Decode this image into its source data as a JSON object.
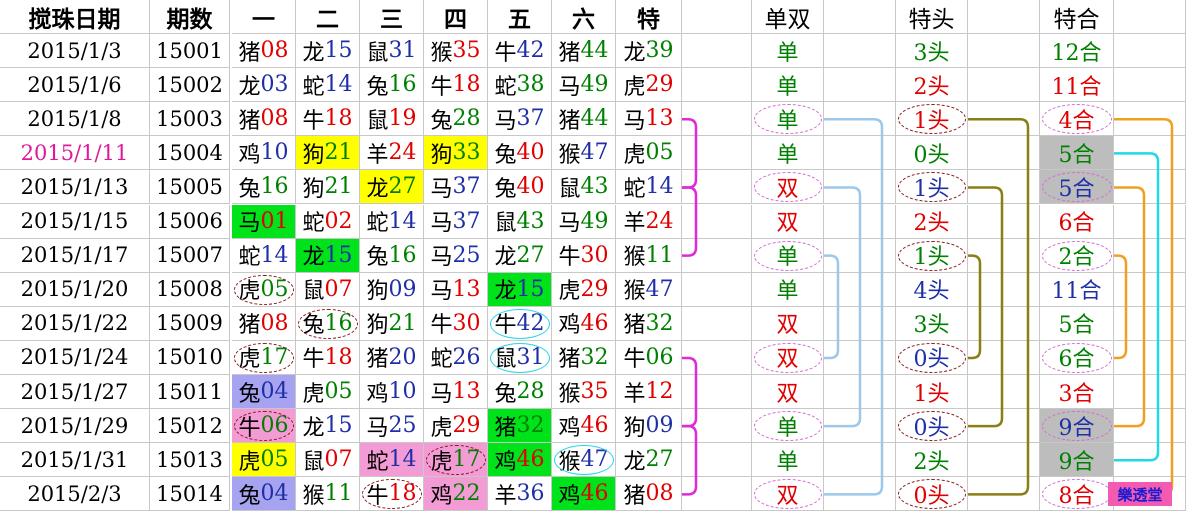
{
  "headers": {
    "date": "搅珠日期",
    "period": "期数",
    "n1": "一",
    "n2": "二",
    "n3": "三",
    "n4": "四",
    "n5": "五",
    "n6": "六",
    "special": "特",
    "odd_even": "单双",
    "head": "特头",
    "sum": "特合"
  },
  "rows": [
    {
      "date": "2015/1/3",
      "period": "15001",
      "nums": [
        [
          "猪",
          "08"
        ],
        [
          "龙",
          "15"
        ],
        [
          "鼠",
          "31"
        ],
        [
          "猴",
          "35"
        ],
        [
          "牛",
          "42"
        ],
        [
          "猪",
          "44"
        ],
        [
          "龙",
          "39"
        ]
      ],
      "oe": "单",
      "head": "3头",
      "sum": "12合"
    },
    {
      "date": "2015/1/6",
      "period": "15002",
      "nums": [
        [
          "龙",
          "03"
        ],
        [
          "蛇",
          "14"
        ],
        [
          "兔",
          "16"
        ],
        [
          "牛",
          "18"
        ],
        [
          "蛇",
          "38"
        ],
        [
          "马",
          "49"
        ],
        [
          "虎",
          "29"
        ]
      ],
      "oe": "单",
      "head": "2头",
      "sum": "11合"
    },
    {
      "date": "2015/1/8",
      "period": "15003",
      "nums": [
        [
          "猪",
          "08"
        ],
        [
          "牛",
          "18"
        ],
        [
          "鼠",
          "19"
        ],
        [
          "兔",
          "28"
        ],
        [
          "马",
          "37"
        ],
        [
          "猪",
          "44"
        ],
        [
          "马",
          "13"
        ]
      ],
      "oe": "单",
      "head": "1头",
      "sum": "4合"
    },
    {
      "date": "2015/1/11",
      "period": "15004",
      "nums": [
        [
          "鸡",
          "10"
        ],
        [
          "狗",
          "21"
        ],
        [
          "羊",
          "24"
        ],
        [
          "狗",
          "33"
        ],
        [
          "兔",
          "40"
        ],
        [
          "猴",
          "47"
        ],
        [
          "虎",
          "05"
        ]
      ],
      "oe": "单",
      "head": "0头",
      "sum": "5合"
    },
    {
      "date": "2015/1/13",
      "period": "15005",
      "nums": [
        [
          "兔",
          "16"
        ],
        [
          "狗",
          "21"
        ],
        [
          "龙",
          "27"
        ],
        [
          "马",
          "37"
        ],
        [
          "兔",
          "40"
        ],
        [
          "鼠",
          "43"
        ],
        [
          "蛇",
          "14"
        ]
      ],
      "oe": "双",
      "head": "1头",
      "sum": "5合"
    },
    {
      "date": "2015/1/15",
      "period": "15006",
      "nums": [
        [
          "马",
          "01"
        ],
        [
          "蛇",
          "02"
        ],
        [
          "蛇",
          "14"
        ],
        [
          "马",
          "37"
        ],
        [
          "鼠",
          "43"
        ],
        [
          "马",
          "49"
        ],
        [
          "羊",
          "24"
        ]
      ],
      "oe": "双",
      "head": "2头",
      "sum": "6合"
    },
    {
      "date": "2015/1/17",
      "period": "15007",
      "nums": [
        [
          "蛇",
          "14"
        ],
        [
          "龙",
          "15"
        ],
        [
          "兔",
          "16"
        ],
        [
          "马",
          "25"
        ],
        [
          "龙",
          "27"
        ],
        [
          "牛",
          "30"
        ],
        [
          "猴",
          "11"
        ]
      ],
      "oe": "单",
      "head": "1头",
      "sum": "2合"
    },
    {
      "date": "2015/1/20",
      "period": "15008",
      "nums": [
        [
          "虎",
          "05"
        ],
        [
          "鼠",
          "07"
        ],
        [
          "狗",
          "09"
        ],
        [
          "马",
          "13"
        ],
        [
          "龙",
          "15"
        ],
        [
          "虎",
          "29"
        ],
        [
          "猴",
          "47"
        ]
      ],
      "oe": "单",
      "head": "4头",
      "sum": "11合"
    },
    {
      "date": "2015/1/22",
      "period": "15009",
      "nums": [
        [
          "猪",
          "08"
        ],
        [
          "兔",
          "16"
        ],
        [
          "狗",
          "21"
        ],
        [
          "牛",
          "30"
        ],
        [
          "牛",
          "42"
        ],
        [
          "鸡",
          "46"
        ],
        [
          "猪",
          "32"
        ]
      ],
      "oe": "双",
      "head": "3头",
      "sum": "5合"
    },
    {
      "date": "2015/1/24",
      "period": "15010",
      "nums": [
        [
          "虎",
          "17"
        ],
        [
          "牛",
          "18"
        ],
        [
          "猪",
          "20"
        ],
        [
          "蛇",
          "26"
        ],
        [
          "鼠",
          "31"
        ],
        [
          "猪",
          "32"
        ],
        [
          "牛",
          "06"
        ]
      ],
      "oe": "双",
      "head": "0头",
      "sum": "6合"
    },
    {
      "date": "2015/1/27",
      "period": "15011",
      "nums": [
        [
          "兔",
          "04"
        ],
        [
          "虎",
          "05"
        ],
        [
          "鸡",
          "10"
        ],
        [
          "马",
          "13"
        ],
        [
          "兔",
          "28"
        ],
        [
          "猴",
          "35"
        ],
        [
          "羊",
          "12"
        ]
      ],
      "oe": "双",
      "head": "1头",
      "sum": "3合"
    },
    {
      "date": "2015/1/29",
      "period": "15012",
      "nums": [
        [
          "牛",
          "06"
        ],
        [
          "龙",
          "15"
        ],
        [
          "马",
          "25"
        ],
        [
          "虎",
          "29"
        ],
        [
          "猪",
          "32"
        ],
        [
          "鸡",
          "46"
        ],
        [
          "狗",
          "09"
        ]
      ],
      "oe": "单",
      "head": "0头",
      "sum": "9合"
    },
    {
      "date": "2015/1/31",
      "period": "15013",
      "nums": [
        [
          "虎",
          "05"
        ],
        [
          "鼠",
          "07"
        ],
        [
          "蛇",
          "14"
        ],
        [
          "虎",
          "17"
        ],
        [
          "鸡",
          "46"
        ],
        [
          "猴",
          "47"
        ],
        [
          "龙",
          "27"
        ]
      ],
      "oe": "单",
      "head": "2头",
      "sum": "9合"
    },
    {
      "date": "2015/2/3",
      "period": "15014",
      "nums": [
        [
          "兔",
          "04"
        ],
        [
          "猴",
          "11"
        ],
        [
          "牛",
          "18"
        ],
        [
          "鸡",
          "22"
        ],
        [
          "羊",
          "36"
        ],
        [
          "鸡",
          "46"
        ],
        [
          "猪",
          "08"
        ]
      ],
      "oe": "双",
      "head": "0头",
      "sum": "8合"
    }
  ],
  "logo": "樂透堂",
  "colors": {
    "red": "#e00000",
    "green": "#008000",
    "blue": "#1f2fa8",
    "pink_date": "#e0189a"
  }
}
